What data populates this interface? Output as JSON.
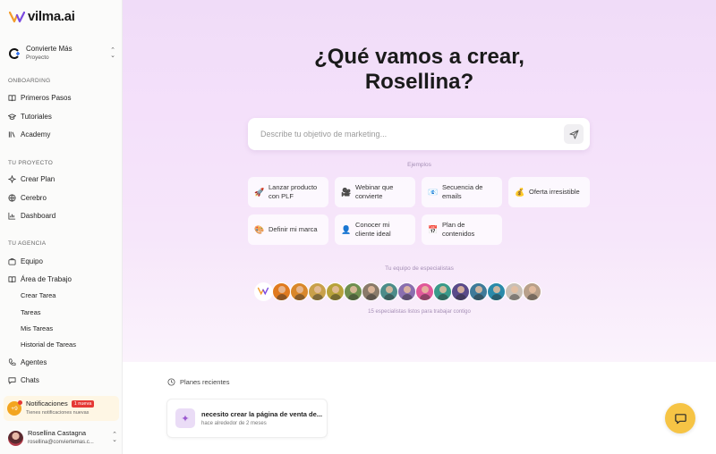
{
  "brand": {
    "name": "vilma.ai"
  },
  "project": {
    "name": "Convierte Más",
    "type": "Proyecto"
  },
  "sidebar": {
    "onboarding_label": "ONBOARDING",
    "onboarding": [
      {
        "label": "Primeros Pasos",
        "icon": "book-open-icon"
      },
      {
        "label": "Tutoriales",
        "icon": "graduation-cap-icon"
      },
      {
        "label": "Academy",
        "icon": "library-icon"
      }
    ],
    "project_label": "TU PROYECTO",
    "project_items": [
      {
        "label": "Crear Plan",
        "icon": "sparkle-icon"
      },
      {
        "label": "Cerebro",
        "icon": "globe-icon"
      },
      {
        "label": "Dashboard",
        "icon": "chart-icon"
      }
    ],
    "agency_label": "TU AGENCIA",
    "agency_items": [
      {
        "label": "Equipo",
        "icon": "briefcase-icon"
      },
      {
        "label": "Área de Trabajo",
        "icon": "book-icon"
      }
    ],
    "workspace_sub": [
      "Crear Tarea",
      "Tareas",
      "Mis Tareas",
      "Historial de Tareas"
    ],
    "bottom_items": [
      {
        "label": "Agentes",
        "icon": "phone-icon"
      },
      {
        "label": "Chats",
        "icon": "chat-icon"
      }
    ]
  },
  "notifications": {
    "count": "+9",
    "title": "Notificaciones",
    "badge": "1 nueva",
    "subtitle": "Tienes notificaciones nuevas"
  },
  "user": {
    "name": "Rosellina Castagna",
    "email": "rosellina@conviertemas.c..."
  },
  "hero": {
    "title_line1": "¿Qué vamos a crear,",
    "title_line2": "Rosellina?",
    "search_placeholder": "Describe tu objetivo de marketing...",
    "examples_label": "Ejemplos",
    "examples": [
      {
        "label": "Lanzar producto con PLF",
        "icon": "🚀"
      },
      {
        "label": "Webinar que convierte",
        "icon": "🎥"
      },
      {
        "label": "Secuencia de emails",
        "icon": "📧"
      },
      {
        "label": "Oferta irresistible",
        "icon": "💰"
      },
      {
        "label": "Definir mi marca",
        "icon": "🎨"
      },
      {
        "label": "Conocer mi cliente ideal",
        "icon": "👤"
      },
      {
        "label": "Plan de contenidos",
        "icon": "📅"
      }
    ],
    "team_label": "Tu equipo de especialistas",
    "team_sub": "15 especialistas listos para trabajar contigo",
    "team_colors": [
      "#ffffff",
      "#e07a1f",
      "#d9872a",
      "#c9a04a",
      "#b7a23a",
      "#6f8f4f",
      "#8a7a6a",
      "#4c8c8a",
      "#8a6fb0",
      "#e0589a",
      "#3a9a8a",
      "#5a4a8a",
      "#3e7a9a",
      "#2a8aaa",
      "#c9c0b6",
      "#b8a08a"
    ]
  },
  "recent": {
    "heading": "Planes recientes",
    "items": [
      {
        "title": "necesito crear la página de venta de...",
        "time": "hace alrededor de 2 meses"
      }
    ]
  },
  "colors": {
    "accent": "#f6c445",
    "hero_bg": "#f0dcf8",
    "badge": "#e53935"
  }
}
